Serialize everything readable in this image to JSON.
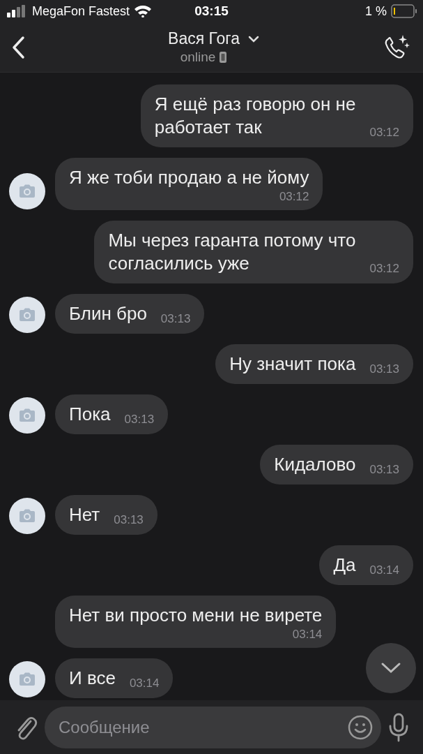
{
  "status_bar": {
    "carrier": "MegaFon Fastest",
    "time": "03:15",
    "battery": "1 %"
  },
  "header": {
    "title": "Вася Гога",
    "status": "online"
  },
  "messages": [
    {
      "kind": "out",
      "lines": [
        "Я ещё раз говорю он не",
        "работает так"
      ],
      "time": "03:12"
    },
    {
      "kind": "in",
      "avatar": true,
      "lines": [
        "Я же тоби продаю а не йому"
      ],
      "time": "03:12"
    },
    {
      "kind": "out",
      "lines": [
        "Мы через гаранта потому что",
        "согласились уже"
      ],
      "time": "03:12"
    },
    {
      "kind": "in",
      "avatar": true,
      "lines": [
        "Блин бро"
      ],
      "time": "03:13"
    },
    {
      "kind": "out",
      "lines": [
        "Ну значит пока"
      ],
      "time": "03:13"
    },
    {
      "kind": "in",
      "avatar": true,
      "lines": [
        "Пока"
      ],
      "time": "03:13"
    },
    {
      "kind": "out",
      "lines": [
        "Кидалово"
      ],
      "time": "03:13"
    },
    {
      "kind": "in",
      "avatar": true,
      "lines": [
        "Нет"
      ],
      "time": "03:13"
    },
    {
      "kind": "out",
      "lines": [
        "Да"
      ],
      "time": "03:14"
    },
    {
      "kind": "in",
      "avatar": false,
      "lines": [
        "Нет ви просто мени не вирете"
      ],
      "time": "03:14"
    },
    {
      "kind": "in",
      "avatar": true,
      "lines": [
        "И все"
      ],
      "time": "03:14"
    }
  ],
  "composer": {
    "placeholder": "Сообщение"
  }
}
